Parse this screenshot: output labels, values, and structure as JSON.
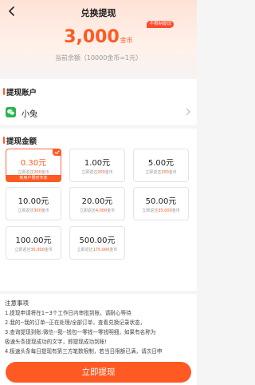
{
  "nav": {
    "title": "兑换提现",
    "back_icon": "arrow-left-icon"
  },
  "balance": {
    "badge": "不限制提现",
    "amount": "3,000",
    "unit": "金币",
    "subtitle": "当前余额（10000金币=1元）"
  },
  "account": {
    "heading": "提现账户",
    "method_icon": "wechat-icon",
    "name": "小兔"
  },
  "amounts": {
    "heading": "提现金额",
    "options": [
      {
        "amount": "0.30元",
        "desc_pre": "立即返还",
        "desc_num": "200",
        "desc_post": "金币",
        "tag": "新用户限时专享",
        "selected": true
      },
      {
        "amount": "1.00元",
        "desc_pre": "立即返还",
        "desc_num": "200",
        "desc_post": "金币"
      },
      {
        "amount": "5.00元",
        "desc_pre": "立即返还",
        "desc_num": "200",
        "desc_post": "金币"
      },
      {
        "amount": "10.00元",
        "desc_pre": "立即返还",
        "desc_num": "300",
        "desc_post": "金币"
      },
      {
        "amount": "20.00元",
        "desc_pre": "立即返还",
        "desc_num": "4,000",
        "desc_post": "金币"
      },
      {
        "amount": "50.00元",
        "desc_pre": "立即返还",
        "desc_num": "35,000",
        "desc_post": "金币"
      },
      {
        "amount": "100.00元",
        "desc_pre": "立即返还",
        "desc_num": "35,000",
        "desc_post": "金币"
      },
      {
        "amount": "500.00元",
        "desc_pre": "立即返还",
        "desc_num": "175,000",
        "desc_post": "金币"
      }
    ]
  },
  "notice": {
    "title": "注意事项",
    "lines": [
      "1.提现申请将在1~3个工作日内审批到账，请耐心等待",
      "2.我的--我的订单--正在处理/全部订单，查看兑换记录状态，",
      "3.查询提现到账:微信--我--钱包一零钱一零钱明细，如果有名称为",
      "极速头条提现成功的文字，即提现成功到账!",
      "4.极速头条每日提现有第三方笔数限制，若当日限额已满，请次日申"
    ]
  },
  "submit_label": "立即提现",
  "colors": {
    "accent": "#ff5a24",
    "wechat": "#2ab550"
  }
}
